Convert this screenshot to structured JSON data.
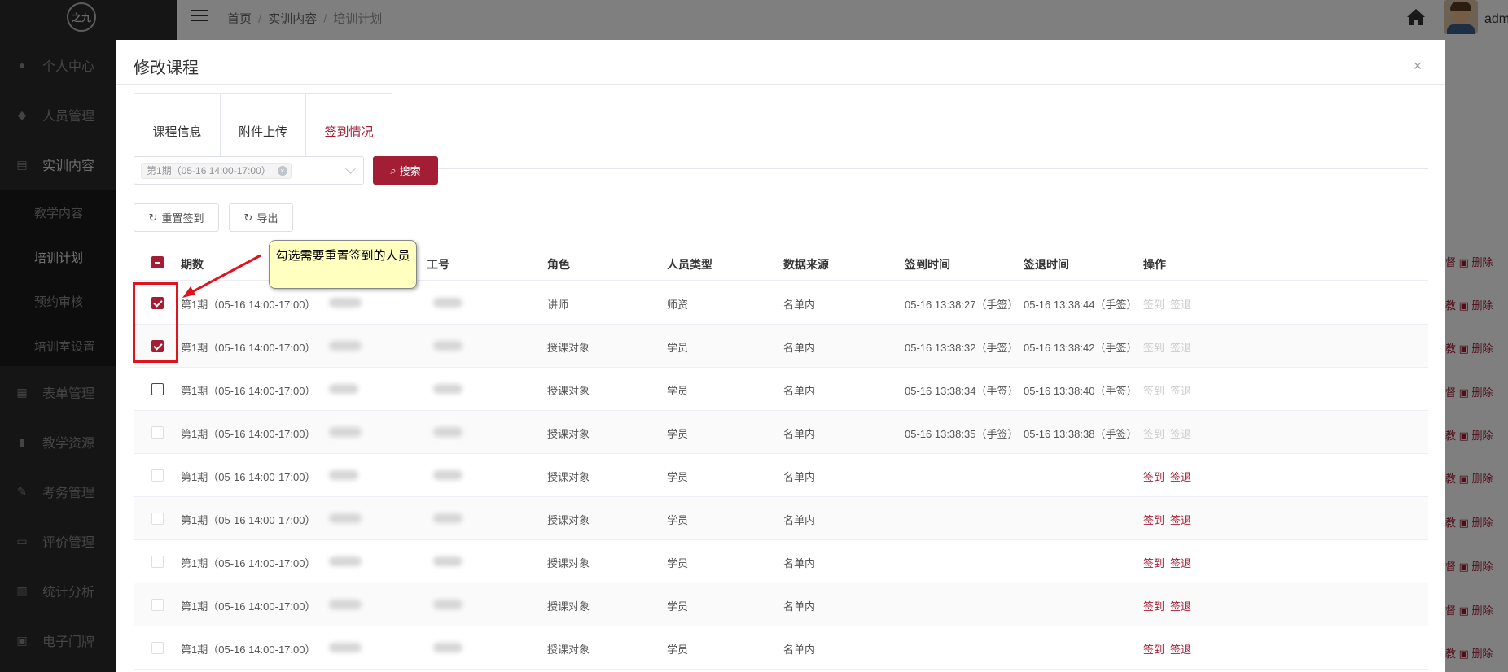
{
  "app": {
    "logo_text": "之九",
    "admin_name": "adm"
  },
  "sidebar": {
    "items": [
      {
        "label": "个人中心",
        "icon": "user-icon"
      },
      {
        "label": "人员管理",
        "icon": "users-icon"
      },
      {
        "label": "实训内容",
        "icon": "content-icon"
      },
      {
        "label": "表单管理",
        "icon": "form-icon"
      },
      {
        "label": "教学资源",
        "icon": "resource-icon"
      },
      {
        "label": "考务管理",
        "icon": "exam-icon"
      },
      {
        "label": "评价管理",
        "icon": "evaluation-icon"
      },
      {
        "label": "统计分析",
        "icon": "chart-icon"
      },
      {
        "label": "电子门牌",
        "icon": "doorplate-icon"
      }
    ],
    "sub_items": [
      "教学内容",
      "培训计划",
      "预约审核",
      "培训室设置"
    ]
  },
  "header": {
    "breadcrumb": [
      "首页",
      "实训内容",
      "培训计划"
    ]
  },
  "modal": {
    "title": "修改课程",
    "tabs": [
      "课程信息",
      "附件上传",
      "签到情况"
    ],
    "active_tab": "签到情况",
    "select_tag": "第1期（05-16 14:00-17:00）",
    "search_label": "搜索",
    "reset_label": "重置签到",
    "export_label": "导出",
    "callout": "勾选需要重置签到的人员"
  },
  "table": {
    "columns": [
      "期数",
      "工号",
      "角色",
      "人员类型",
      "数据来源",
      "签到时间",
      "签退时间",
      "操作"
    ],
    "action_signin": "签到",
    "action_signout": "签退",
    "rows": [
      {
        "period": "第1期（05-16 14:00-17:00）",
        "role": "讲师",
        "type": "师资",
        "source": "名单内",
        "signin": "05-16 13:38:27（手签）",
        "signout": "05-16 13:38:44（手签）",
        "checked": true,
        "actions_enabled": false
      },
      {
        "period": "第1期（05-16 14:00-17:00）",
        "role": "授课对象",
        "type": "学员",
        "source": "名单内",
        "signin": "05-16 13:38:32（手签）",
        "signout": "05-16 13:38:42（手签）",
        "checked": true,
        "actions_enabled": false
      },
      {
        "period": "第1期（05-16 14:00-17:00）",
        "role": "授课对象",
        "type": "学员",
        "source": "名单内",
        "signin": "05-16 13:38:34（手签）",
        "signout": "05-16 13:38:40（手签）",
        "checked": false,
        "actions_enabled": false
      },
      {
        "period": "第1期（05-16 14:00-17:00）",
        "role": "授课对象",
        "type": "学员",
        "source": "名单内",
        "signin": "05-16 13:38:35（手签）",
        "signout": "05-16 13:38:38（手签）",
        "checked": false,
        "actions_enabled": false
      },
      {
        "period": "第1期（05-16 14:00-17:00）",
        "role": "授课对象",
        "type": "学员",
        "source": "名单内",
        "signin": "",
        "signout": "",
        "checked": false,
        "actions_enabled": true
      },
      {
        "period": "第1期（05-16 14:00-17:00）",
        "role": "授课对象",
        "type": "学员",
        "source": "名单内",
        "signin": "",
        "signout": "",
        "checked": false,
        "actions_enabled": true
      },
      {
        "period": "第1期（05-16 14:00-17:00）",
        "role": "授课对象",
        "type": "学员",
        "source": "名单内",
        "signin": "",
        "signout": "",
        "checked": false,
        "actions_enabled": true
      },
      {
        "period": "第1期（05-16 14:00-17:00）",
        "role": "授课对象",
        "type": "学员",
        "source": "名单内",
        "signin": "",
        "signout": "",
        "checked": false,
        "actions_enabled": true
      },
      {
        "period": "第1期（05-16 14:00-17:00）",
        "role": "授课对象",
        "type": "学员",
        "source": "名单内",
        "signin": "",
        "signout": "",
        "checked": false,
        "actions_enabled": true
      }
    ]
  },
  "background_ops": {
    "op_a": "教",
    "op_b": "删除",
    "op_c": "督"
  },
  "colors": {
    "accent": "#a31d35",
    "sidebar": "#2b2b2b"
  }
}
